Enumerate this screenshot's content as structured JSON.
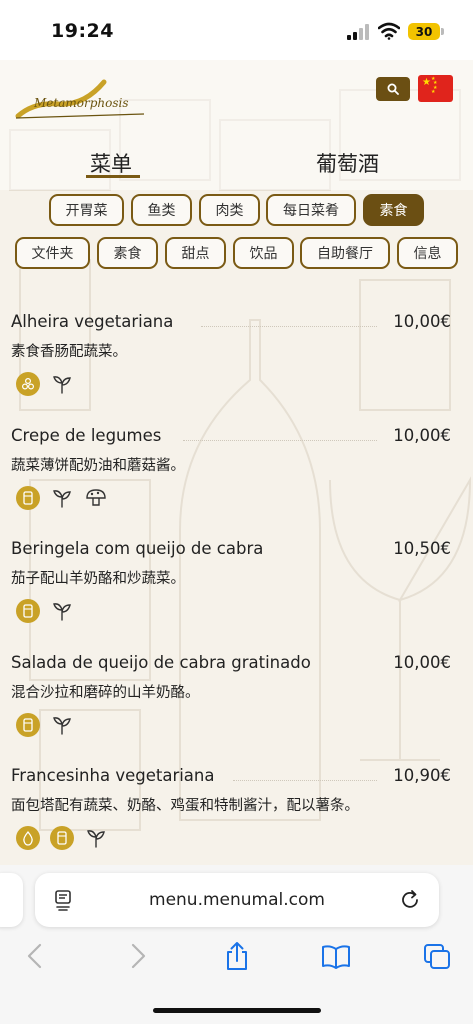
{
  "status_bar": {
    "time": "19:24",
    "battery": "30"
  },
  "header": {
    "logo_text": "Metamorphosis"
  },
  "tabs": [
    {
      "label": "菜单"
    },
    {
      "label": "葡萄酒"
    }
  ],
  "categories_row1": [
    "开胃菜",
    "鱼类",
    "肉类",
    "每日菜肴",
    "素食"
  ],
  "categories_row2": [
    "文件夹",
    "素食",
    "甜点",
    "饮品",
    "自助餐厅",
    "信息"
  ],
  "menu_items": [
    {
      "name": "Alheira vegetariana",
      "price": "10,00€",
      "desc": "素食香肠配蔬菜。"
    },
    {
      "name": "Crepe de legumes",
      "price": "10,00€",
      "desc": "蔬菜薄饼配奶油和蘑菇酱。"
    },
    {
      "name": "Beringela com queijo de cabra",
      "price": "10,50€",
      "desc": "茄子配山羊奶酪和炒蔬菜。"
    },
    {
      "name": "Salada de queijo de cabra gratinado",
      "price": "10,00€",
      "desc": "混合沙拉和磨碎的山羊奶酪。"
    },
    {
      "name": "Francesinha vegetariana",
      "price": "10,90€",
      "desc": "面包塔配有蔬菜、奶酪、鸡蛋和特制酱汁，配以薯条。"
    }
  ],
  "browser": {
    "url": "menu.menumal.com"
  },
  "colors": {
    "accent": "#6b4f13",
    "gold": "#c9a227"
  }
}
